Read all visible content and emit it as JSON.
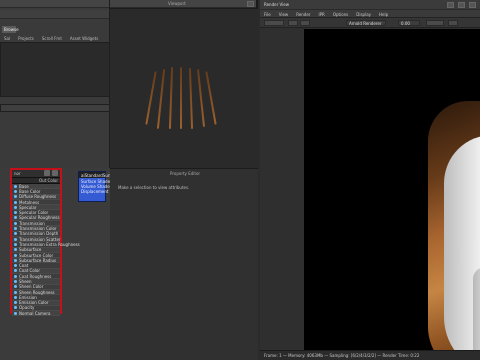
{
  "left_panel": {
    "tabs": [
      "Sal",
      "Projects",
      "Scroll Fmt",
      "Asset Widgets"
    ],
    "browse_label": "Browse",
    "attr_rows": [
      "Base",
      "Base Color",
      "Diffuse Roughness",
      "Metalness",
      "Specular",
      "Specular Color",
      "Specular Roughness",
      "Transmission",
      "Transmission Color",
      "Transmission Depth",
      "Transmission Scatter",
      "Transmission Extra Roughness",
      "Subsurface",
      "Subsurface Color",
      "Subsurface Radius",
      "Coat",
      "Coat Color",
      "Coat Roughness",
      "Sheen",
      "Sheen Color",
      "Sheen Roughness",
      "Emission",
      "Emission Color",
      "Opacity",
      "Normal Camera"
    ],
    "node_title": "nor",
    "out_label": "Out Color"
  },
  "shader_node": {
    "title": "aiStandardSurface",
    "lines": [
      "Surface Shader",
      "Volume Shader",
      "Displacement Shader"
    ]
  },
  "middle_panel": {
    "title": "Viewport",
    "property_title": "Property Editor",
    "message": "Make a selection to view attributes."
  },
  "render_view": {
    "title": "Render View",
    "menu": [
      "File",
      "View",
      "Render",
      "IPR",
      "Options",
      "Display",
      "Help"
    ],
    "renderer_select": "Arnold Renderer",
    "exposure_value": "0.00",
    "status_text": "Frame: 1 — Memory: 4063Mb — Sampling: [6/2/4/3/2/2] — Render Time: 0:22"
  }
}
